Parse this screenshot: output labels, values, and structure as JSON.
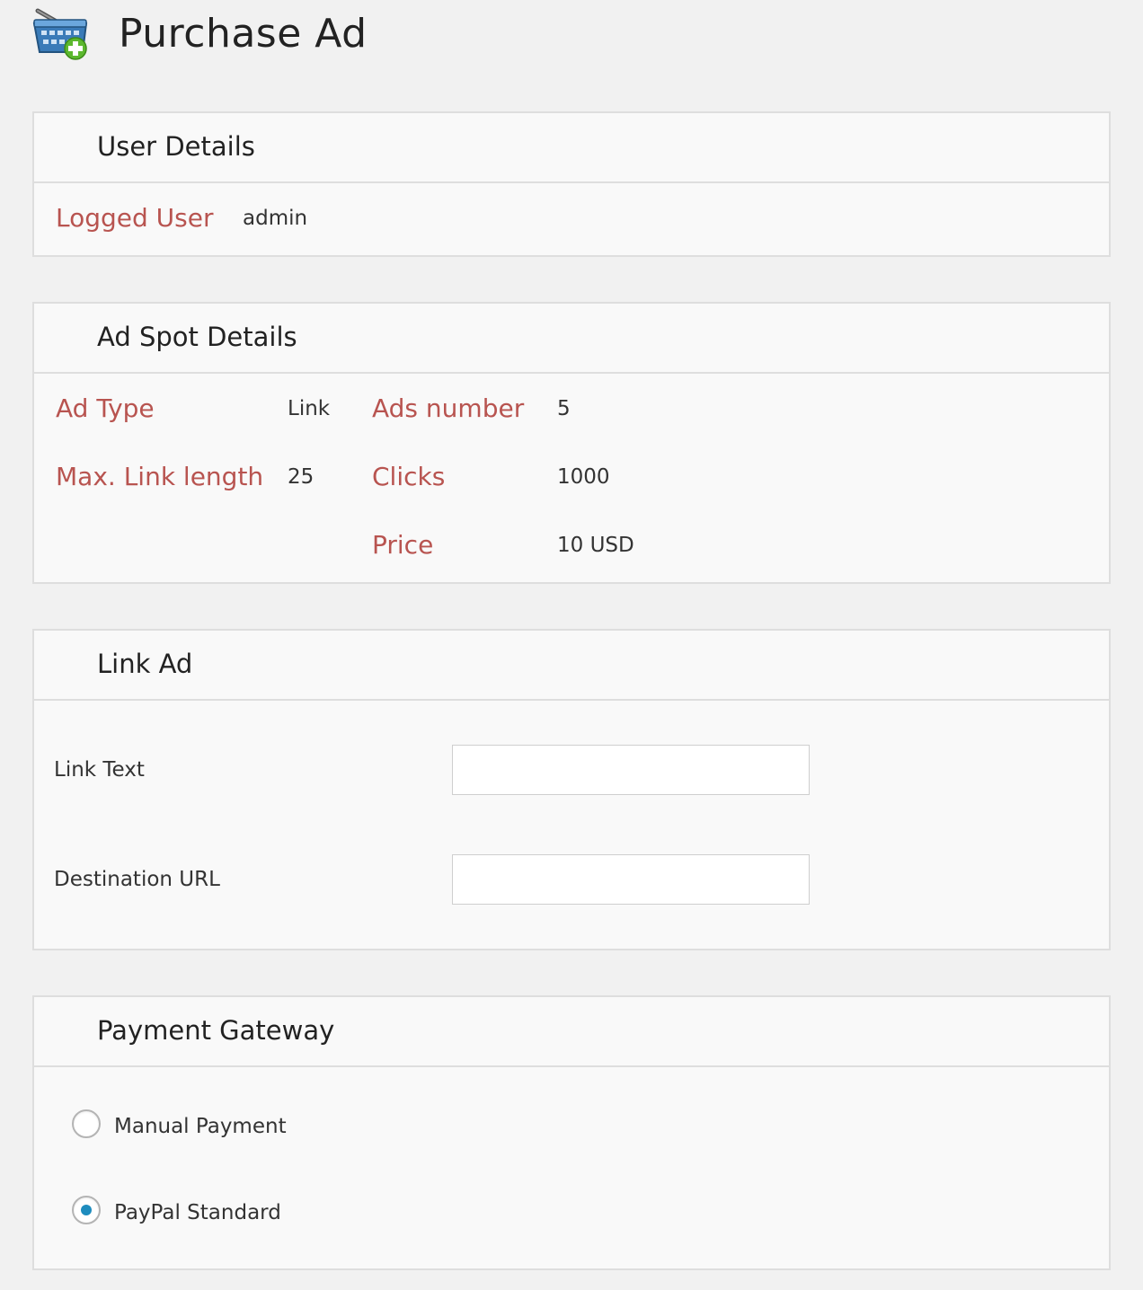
{
  "page": {
    "title": "Purchase Ad",
    "icon": "shopping-basket-add-icon"
  },
  "user_details": {
    "title": "User Details",
    "logged_user_label": "Logged User",
    "logged_user_value": "admin"
  },
  "ad_spot": {
    "title": "Ad Spot Details",
    "ad_type_label": "Ad Type",
    "ad_type_value": "Link",
    "ads_number_label": "Ads number",
    "ads_number_value": "5",
    "max_link_label": "Max. Link length",
    "max_link_value": "25",
    "clicks_label": "Clicks",
    "clicks_value": "1000",
    "price_label": "Price",
    "price_value": "10 USD"
  },
  "link_ad": {
    "title": "Link Ad",
    "link_text_label": "Link Text",
    "link_text_value": "",
    "destination_url_label": "Destination URL",
    "destination_url_value": ""
  },
  "payment": {
    "title": "Payment Gateway",
    "options": [
      {
        "label": "Manual Payment",
        "checked": false
      },
      {
        "label": "PayPal Standard",
        "checked": true
      }
    ]
  },
  "colors": {
    "label_accent": "#b85450",
    "radio_selected": "#1e8cbe"
  }
}
